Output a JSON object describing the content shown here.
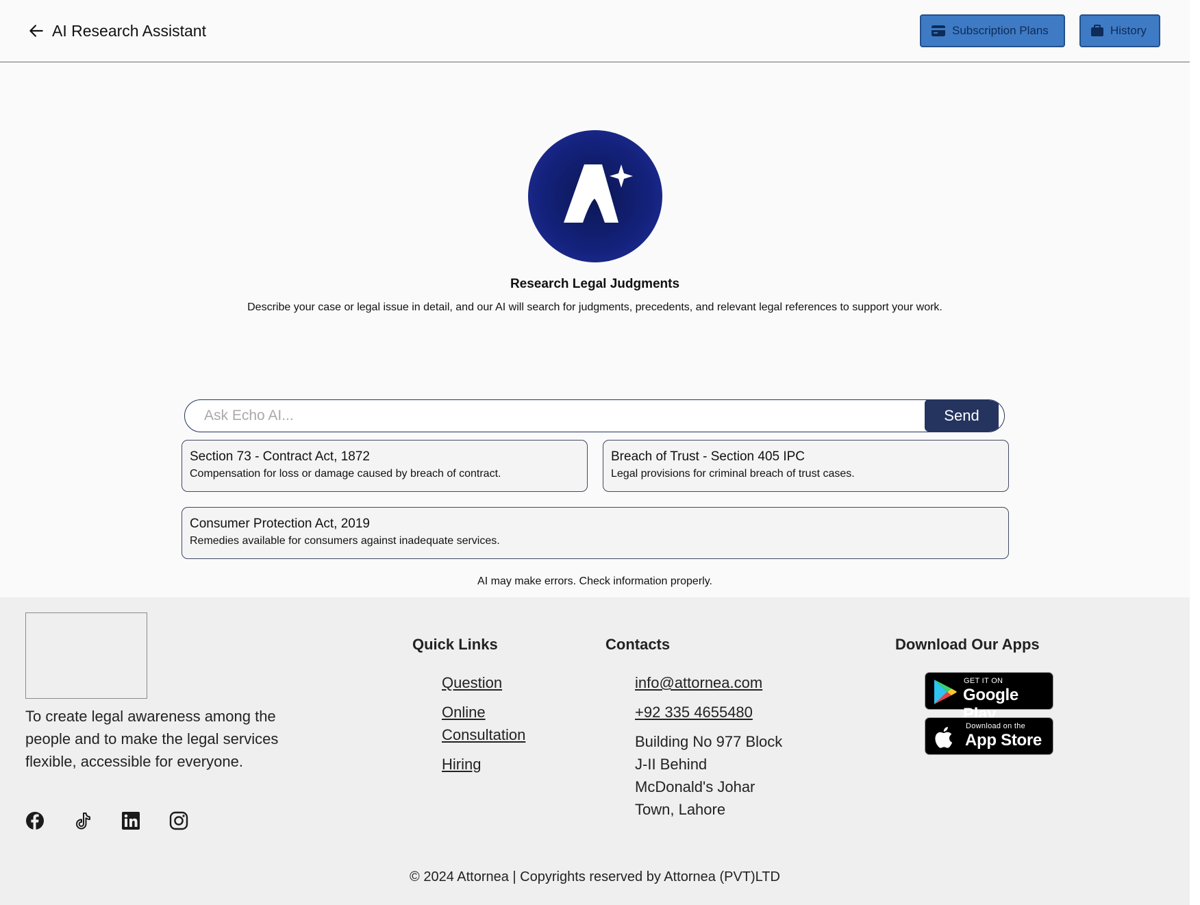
{
  "header": {
    "title": "AI Research Assistant",
    "subscription_label": "Subscription Plans",
    "history_label": "History"
  },
  "hero": {
    "title": "Research Legal Judgments",
    "description": "Describe your case or legal issue in detail, and our AI will search for judgments, precedents, and relevant legal references to support your work."
  },
  "chat": {
    "placeholder": "Ask Echo AI...",
    "value": "",
    "send_label": "Send"
  },
  "suggestions": [
    {
      "title": "Section 73 - Contract Act, 1872",
      "description": "Compensation for loss or damage caused by breach of contract."
    },
    {
      "title": "Breach of Trust - Section 405 IPC",
      "description": "Legal provisions for criminal breach of trust cases."
    },
    {
      "title": "Consumer Protection Act, 2019",
      "description": "Remedies available for consumers against inadequate services."
    }
  ],
  "disclaimer": "AI may make errors. Check information properly.",
  "footer": {
    "tagline": "To create legal awareness among the people and to make the legal services flexible, accessible for everyone.",
    "quick_links_heading": "Quick Links",
    "quick_links": [
      "Question",
      "Online Consultation",
      "Hiring"
    ],
    "contacts_heading": "Contacts",
    "email": "info@attornea.com",
    "phone": "+92 335 4655480",
    "address": "Building No 977 Block J-II Behind McDonald's Johar Town, Lahore",
    "apps_heading": "Download Our Apps",
    "google_play": {
      "small": "GET IT ON",
      "big": "Google Play"
    },
    "app_store": {
      "small": "Download on the",
      "big": "App Store"
    },
    "socials": [
      "facebook-icon",
      "tiktok-icon",
      "linkedin-icon",
      "instagram-icon"
    ],
    "copyright": "© 2024 Attornea | Copyrights reserved by Attornea (PVT)LTD"
  },
  "colors": {
    "primary_button": "#3e7bc4",
    "send_button": "#24345f",
    "logo_navy": "#13217a"
  }
}
